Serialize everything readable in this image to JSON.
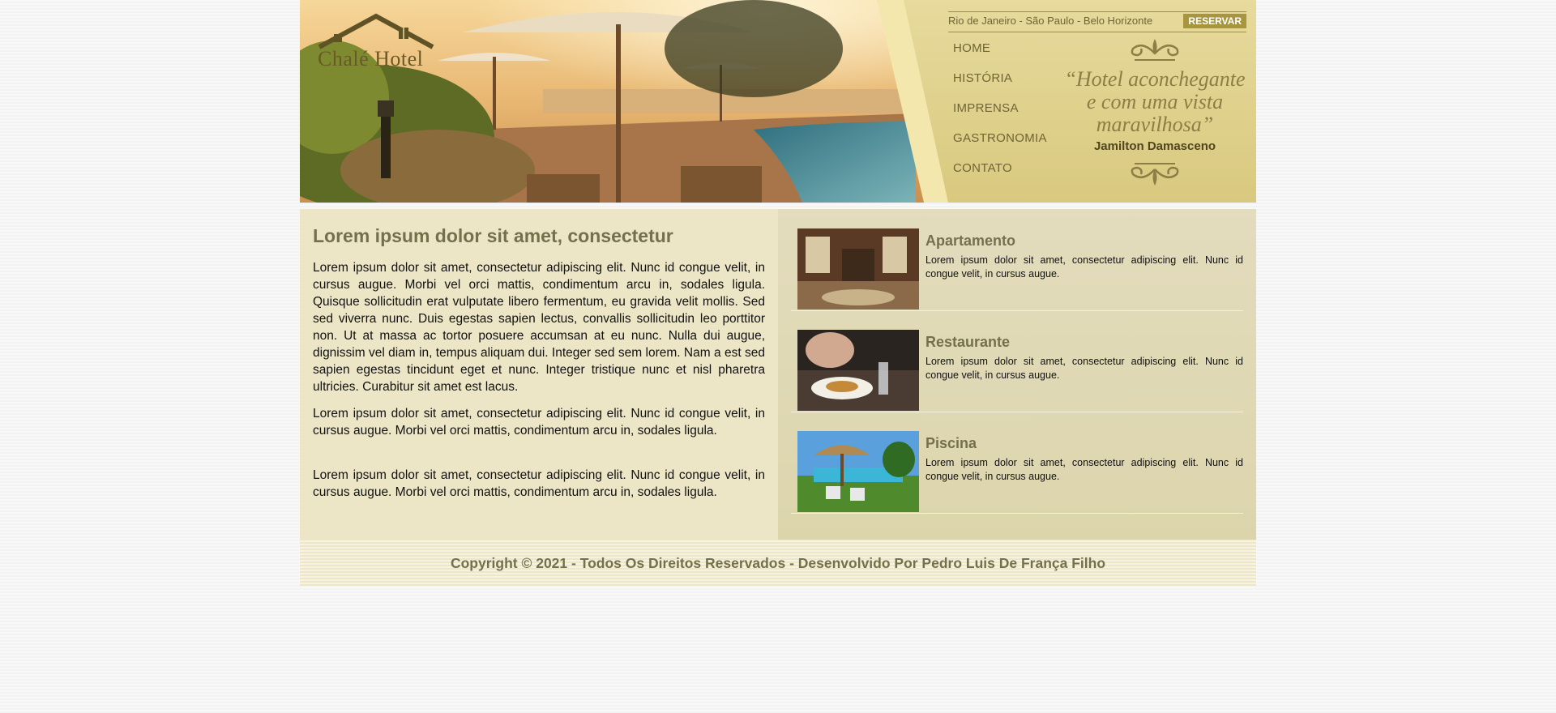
{
  "header": {
    "logo_text": "Chalé Hotel",
    "cities": "Rio de Janeiro - São Paulo - Belo Horizonte",
    "reserve_label": "RESERVAR",
    "nav": [
      {
        "label": "HOME"
      },
      {
        "label": "HISTÓRIA"
      },
      {
        "label": "IMPRENSA"
      },
      {
        "label": "GASTRONOMIA"
      },
      {
        "label": "CONTATO"
      }
    ],
    "quote": "“Hotel aconchegante e com uma vista maravilhosa”",
    "quote_author": "Jamilton Damasceno"
  },
  "main": {
    "title": "Lorem ipsum dolor sit amet, consectetur",
    "paragraphs": [
      "Lorem ipsum dolor sit amet, consectetur adipiscing elit. Nunc id congue velit, in cursus augue. Morbi vel orci mattis, condimentum arcu in, sodales ligula. Quisque sollicitudin erat vulputate libero fermentum, eu gravida velit mollis. Sed sed viverra nunc. Duis egestas sapien lectus, convallis sollicitudin leo porttitor non. Ut at massa ac tortor posuere accumsan at eu nunc. Nulla dui augue, dignissim vel diam in, tempus aliquam dui. Integer sed sem lorem. Nam a est sed sapien egestas tincidunt eget et nunc. Integer tristique nunc et nisl pharetra ultricies. Curabitur sit amet est lacus.",
      "Lorem ipsum dolor sit amet, consectetur adipiscing elit. Nunc id congue velit, in cursus augue. Morbi vel orci mattis, condimentum arcu in, sodales ligula.",
      "Lorem ipsum dolor sit amet, consectetur adipiscing elit. Nunc id congue velit, in cursus augue. Morbi vel orci mattis, condimentum arcu in, sodales ligula."
    ]
  },
  "features": [
    {
      "title": "Apartamento",
      "description": "Lorem ipsum dolor sit amet, consectetur adipiscing elit. Nunc id congue velit, in cursus augue."
    },
    {
      "title": "Restaurante",
      "description": "Lorem ipsum dolor sit amet, consectetur adipiscing elit. Nunc id congue velit, in cursus augue."
    },
    {
      "title": "Piscina",
      "description": "Lorem ipsum dolor sit amet, consectetur adipiscing elit. Nunc id congue velit, in cursus augue."
    }
  ],
  "footer": {
    "copyright": "Copyright © 2021 - Todos Os Direitos Reservados - Desenvolvido Por Pedro Luis De França Filho"
  },
  "colors": {
    "accent": "#a8953f",
    "heading": "#75704c",
    "panel": "#dfd08a"
  }
}
